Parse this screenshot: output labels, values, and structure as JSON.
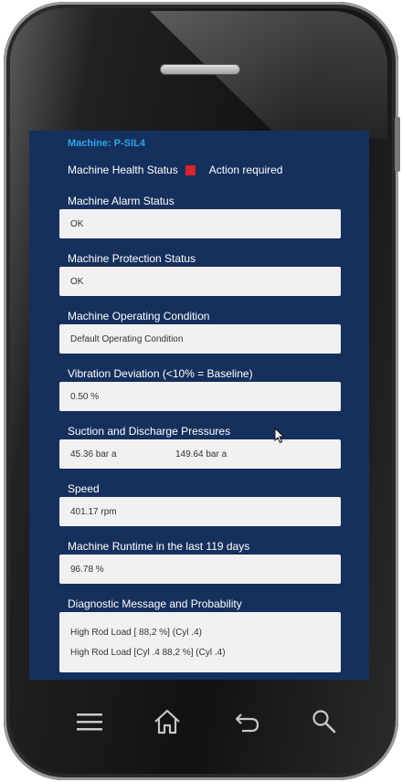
{
  "machine": {
    "title": "Machine: P-SIL4"
  },
  "health": {
    "label": "Machine Health Status",
    "status": "Action required",
    "indicator_color": "#d9232e"
  },
  "sections": [
    {
      "label": "Machine Alarm Status",
      "value": "OK"
    },
    {
      "label": "Machine Protection Status",
      "value": "OK"
    },
    {
      "label": "Machine Operating Condition",
      "value": "Default Operating Condition"
    },
    {
      "label": "Vibration Deviation (<10% = Baseline)",
      "value": "0.50 %"
    },
    {
      "label": "Suction and Discharge Pressures",
      "value": "45.36 bar a",
      "value2": "149.64 bar a"
    },
    {
      "label": "Speed",
      "value": "401.17 rpm"
    },
    {
      "label": "Machine Runtime in the last 119 days",
      "value": "96.78 %"
    },
    {
      "label": "Diagnostic Message and Probability",
      "lines": [
        "High Rod Load [ 88,2 %] (Cyl .4)",
        "High Rod Load [Cyl .4 88,2 %] (Cyl .4)"
      ]
    }
  ],
  "nav": {
    "icons": [
      "menu-icon",
      "home-icon",
      "back-icon",
      "search-icon"
    ]
  },
  "colors": {
    "screen_bg": "#16305d",
    "title_accent": "#2aa6e6",
    "field_bg": "#f1f1f1"
  }
}
